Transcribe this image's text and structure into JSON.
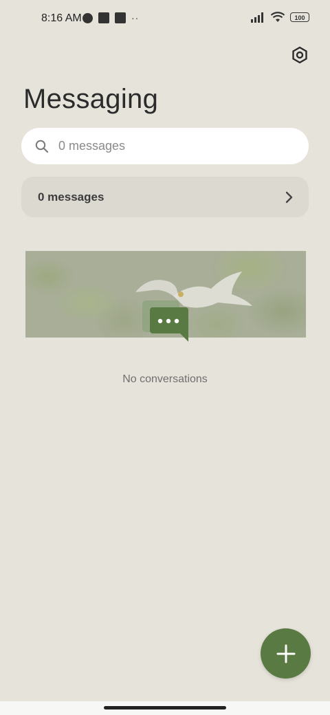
{
  "status_bar": {
    "time": "8:16 AM",
    "battery": "100"
  },
  "header": {
    "title": "Messaging",
    "settings_icon": "settings-icon"
  },
  "search": {
    "placeholder": "0 messages"
  },
  "summary": {
    "label": "0 messages"
  },
  "empty_state": {
    "text": "No conversations"
  },
  "fab": {
    "icon": "plus-icon"
  },
  "colors": {
    "accent": "#5a7a44",
    "background": "#e6e3da"
  }
}
